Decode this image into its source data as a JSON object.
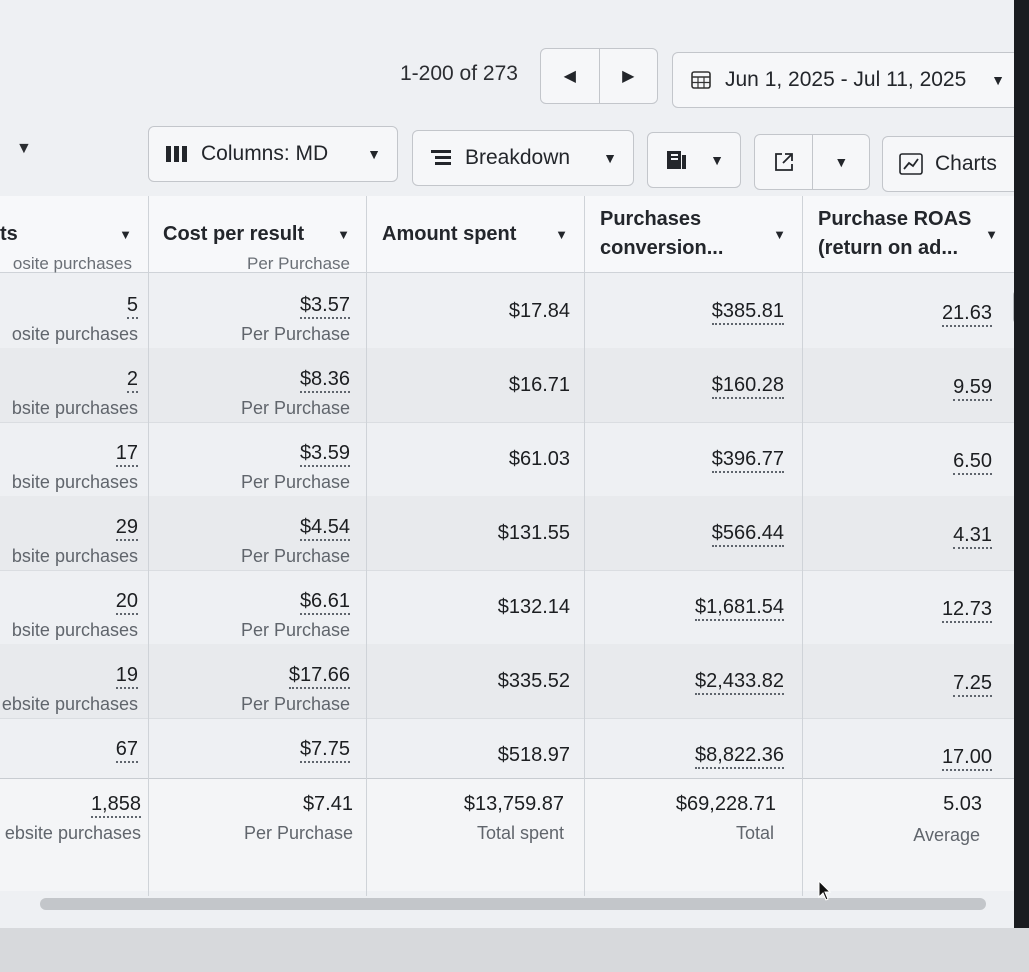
{
  "pagination": {
    "range": "1-200 of 273"
  },
  "date_range": "Jun 1, 2025 - Jul 11, 2025",
  "toolbar": {
    "columns_label": "Columns: MD",
    "breakdown_label": "Breakdown",
    "charts_label": "Charts"
  },
  "table": {
    "headers": {
      "results": "ts",
      "cost": "Cost per result",
      "spent": "Amount spent",
      "purch_line1": "Purchases",
      "purch_line2": "conversion...",
      "roas_line1": "Purchase ROAS",
      "roas_line2": "(return on ad..."
    },
    "peek": {
      "results": "osite purchases",
      "cost": "Per Purchase"
    },
    "rows": [
      {
        "results": "5",
        "results_sub": "osite purchases",
        "cost": "$3.57",
        "cost_sub": "Per Purchase",
        "spent": "$17.84",
        "value": "$385.81",
        "roas": "21.63"
      },
      {
        "results": "2",
        "results_sub": "bsite purchases",
        "cost": "$8.36",
        "cost_sub": "Per Purchase",
        "spent": "$16.71",
        "value": "$160.28",
        "roas": "9.59"
      },
      {
        "results": "17",
        "results_sub": "bsite purchases",
        "cost": "$3.59",
        "cost_sub": "Per Purchase",
        "spent": "$61.03",
        "value": "$396.77",
        "roas": "6.50"
      },
      {
        "results": "29",
        "results_sub": "bsite purchases",
        "cost": "$4.54",
        "cost_sub": "Per Purchase",
        "spent": "$131.55",
        "value": "$566.44",
        "roas": "4.31"
      },
      {
        "results": "20",
        "results_sub": "bsite purchases",
        "cost": "$6.61",
        "cost_sub": "Per Purchase",
        "spent": "$132.14",
        "value": "$1,681.54",
        "roas": "12.73"
      },
      {
        "results": "19",
        "results_sub": "ebsite purchases",
        "cost": "$17.66",
        "cost_sub": "Per Purchase",
        "spent": "$335.52",
        "value": "$2,433.82",
        "roas": "7.25"
      },
      {
        "results": "67",
        "results_sub": "",
        "cost": "$7.75",
        "cost_sub": "",
        "spent": "$518.97",
        "value": "$8,822.36",
        "roas": "17.00"
      }
    ],
    "totals": {
      "results": "1,858",
      "results_sub": "ebsite purchases",
      "cost": "$7.41",
      "cost_sub": "Per Purchase",
      "spent": "$13,759.87",
      "spent_sub": "Total spent",
      "value": "$69,228.71",
      "value_sub": "Total",
      "roas": "5.03",
      "roas_sub": "Average"
    }
  },
  "colors": {
    "background": "#eef0f3",
    "text": "#1c1e21",
    "muted": "#60656c",
    "border": "#cfd3d8"
  }
}
